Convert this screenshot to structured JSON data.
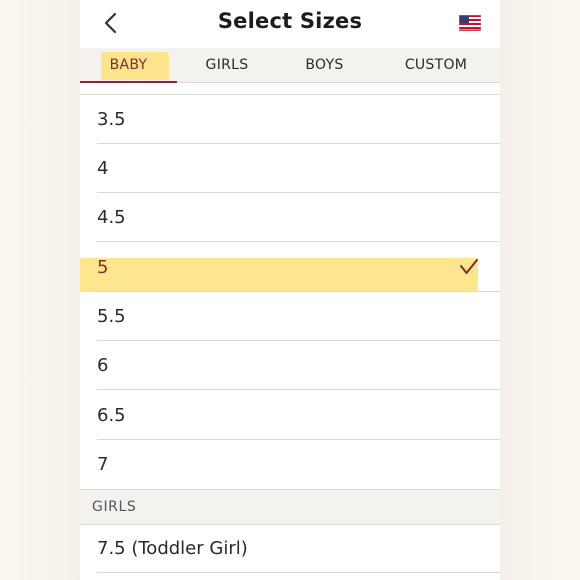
{
  "header": {
    "title": "Select Sizes",
    "back_icon": "chevron-left-icon",
    "flag_icon": "us-flag-icon"
  },
  "tabs": [
    {
      "label": "BABY",
      "active": true
    },
    {
      "label": "GIRLS",
      "active": false
    },
    {
      "label": "BOYS",
      "active": false
    },
    {
      "label": "CUSTOM",
      "active": false
    }
  ],
  "baby_sizes": [
    {
      "label": "3.5",
      "selected": false
    },
    {
      "label": "4",
      "selected": false
    },
    {
      "label": "4.5",
      "selected": false
    },
    {
      "label": "5",
      "selected": true
    },
    {
      "label": "5.5",
      "selected": false
    },
    {
      "label": "6",
      "selected": false
    },
    {
      "label": "6.5",
      "selected": false
    },
    {
      "label": "7",
      "selected": false
    }
  ],
  "girls_section": {
    "title": "GIRLS",
    "sizes": [
      {
        "label": "7.5 (Toddler Girl)",
        "selected": false
      }
    ]
  },
  "colors": {
    "accent": "#8a2732",
    "highlight": "#fde27a",
    "text": "#2a2a2a",
    "tab_background": "#f4f2ee",
    "divider": "#dcd8d2"
  }
}
